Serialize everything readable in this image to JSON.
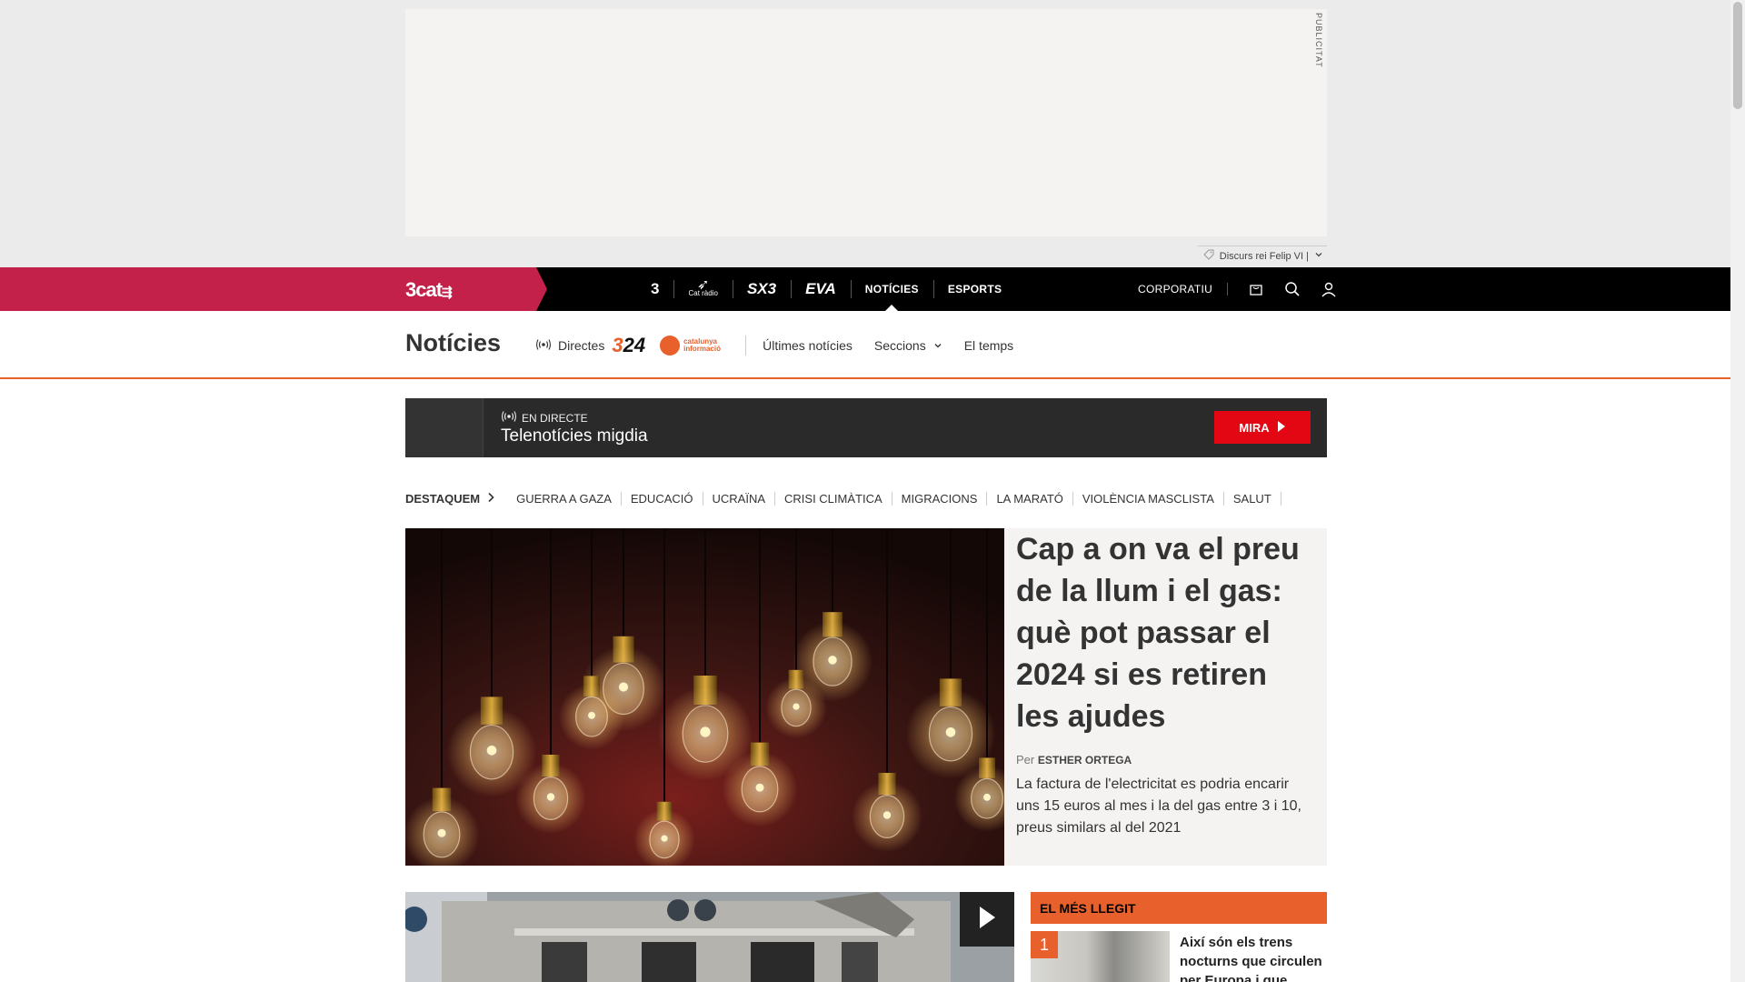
{
  "ad": {
    "label": "PUBLICITAT"
  },
  "pill": {
    "text": "Discurs rei Felip VI |"
  },
  "topbar": {
    "brand": "3cat",
    "channels": [
      {
        "label": "3",
        "icon": "tv3-logo"
      },
      {
        "label": "Cat ràdio",
        "icon": "catradio-logo"
      },
      {
        "label": "SX3",
        "icon": "sx3-logo"
      },
      {
        "label": "EVA",
        "icon": "eva-logo"
      },
      {
        "label": "NOTÍCIES"
      },
      {
        "label": "ESPORTS"
      }
    ],
    "corporate": "CORPORATIU"
  },
  "section": {
    "title": "Notícies",
    "directes": "Directes",
    "logo324_a": "3",
    "logo324_b": "24",
    "ci_logo": "catalunya informació",
    "links": [
      "Últimes notícies",
      "Seccions",
      "El temps"
    ]
  },
  "live": {
    "label": "EN DIRECTE",
    "title": "Telenotícies migdia",
    "button": "MIRA"
  },
  "destaquem": {
    "head": "DESTAQUEM",
    "tags": [
      "GUERRA A GAZA",
      "EDUCACIÓ",
      "UCRAÏNA",
      "CRISI CLIMÀTICA",
      "MIGRACIONS",
      "LA MARATÓ",
      "VIOLÈNCIA MASCLISTA",
      "SALUT"
    ]
  },
  "hero": {
    "headline": "Cap a on va el preu de la llum i el gas: què pot passar el 2024 si es retiren les ajudes",
    "by_prefix": "Per",
    "author": "ESTHER ORTEGA",
    "lead": "La factura de l'electricitat es podria encarir uns 15 euros al mes i la del gas entre 3 i 10, preus similars al del 2021"
  },
  "mostread": {
    "header": "EL MÉS LLEGIT",
    "items": [
      {
        "num": "1",
        "title": "Així són els trens nocturns que circulen per Europa i que"
      }
    ]
  },
  "colors": {
    "brand_red": "#c3204a",
    "accent_orange": "#e8602c",
    "live_red": "#e30613"
  }
}
